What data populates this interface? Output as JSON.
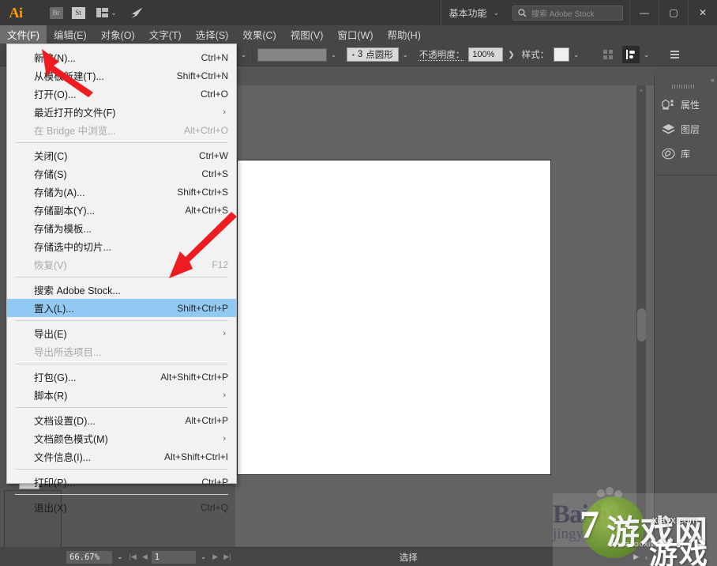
{
  "app": {
    "name": "Adobe Illustrator",
    "logo_text": "Ai"
  },
  "titlebar": {
    "bridge_icon_label": "Br",
    "stock_icon_label": "St",
    "workspace": "基本功能",
    "workspace_chevron": "⌄",
    "search_placeholder": "搜索 Adobe Stock",
    "minimize": "—",
    "maximize": "▢",
    "close": "✕"
  },
  "menubar": {
    "items": [
      {
        "label": "文件(F)",
        "active": true
      },
      {
        "label": "编辑(E)",
        "active": false
      },
      {
        "label": "对象(O)",
        "active": false
      },
      {
        "label": "文字(T)",
        "active": false
      },
      {
        "label": "选择(S)",
        "active": false
      },
      {
        "label": "效果(C)",
        "active": false
      },
      {
        "label": "视图(V)",
        "active": false
      },
      {
        "label": "窗口(W)",
        "active": false
      },
      {
        "label": "帮助(H)",
        "active": false
      }
    ]
  },
  "controlbar": {
    "chevron": "⌄",
    "stroke_dot": "▪",
    "stroke_value": "3",
    "stroke_profile": "点圆形",
    "opacity_label": "不透明度：",
    "opacity_value": "100%",
    "opacity_arrow": "❯",
    "style_label": "样式：",
    "fill_swatch_color": "#858585",
    "style_swatch_color": "#f0f0f0"
  },
  "doctab": {
    "close_glyph": "✖"
  },
  "right_panel": {
    "collapse_glyph": "«",
    "items": [
      {
        "label": "属性",
        "icon": "properties-icon"
      },
      {
        "label": "图层",
        "icon": "layers-icon"
      },
      {
        "label": "库",
        "icon": "libraries-icon"
      }
    ]
  },
  "statusbar": {
    "zoom_value": "66.67%",
    "zoom_chevron": "⌄",
    "nav_first": "|◀",
    "nav_prev": "◀",
    "page_value": "1",
    "page_chevron": "⌄",
    "nav_next": "▶",
    "nav_last": "▶|",
    "status_text": "选择",
    "right_play": "▶",
    "right_chev": "‹"
  },
  "file_menu": {
    "items": [
      {
        "label": "新建(N)...",
        "accel": "Ctrl+N",
        "disabled": false,
        "submenu": false,
        "selected": false,
        "sep_after": false
      },
      {
        "label": "从模板新建(T)...",
        "accel": "Shift+Ctrl+N",
        "disabled": false,
        "submenu": false,
        "selected": false,
        "sep_after": false
      },
      {
        "label": "打开(O)...",
        "accel": "Ctrl+O",
        "disabled": false,
        "submenu": false,
        "selected": false,
        "sep_after": false
      },
      {
        "label": "最近打开的文件(F)",
        "accel": "",
        "disabled": false,
        "submenu": true,
        "selected": false,
        "sep_after": false
      },
      {
        "label": "在 Bridge 中浏览...",
        "accel": "Alt+Ctrl+O",
        "disabled": true,
        "submenu": false,
        "selected": false,
        "sep_after": true
      },
      {
        "label": "关闭(C)",
        "accel": "Ctrl+W",
        "disabled": false,
        "submenu": false,
        "selected": false,
        "sep_after": false
      },
      {
        "label": "存储(S)",
        "accel": "Ctrl+S",
        "disabled": false,
        "submenu": false,
        "selected": false,
        "sep_after": false
      },
      {
        "label": "存储为(A)...",
        "accel": "Shift+Ctrl+S",
        "disabled": false,
        "submenu": false,
        "selected": false,
        "sep_after": false
      },
      {
        "label": "存储副本(Y)...",
        "accel": "Alt+Ctrl+S",
        "disabled": false,
        "submenu": false,
        "selected": false,
        "sep_after": false
      },
      {
        "label": "存储为模板...",
        "accel": "",
        "disabled": false,
        "submenu": false,
        "selected": false,
        "sep_after": false
      },
      {
        "label": "存储选中的切片...",
        "accel": "",
        "disabled": false,
        "submenu": false,
        "selected": false,
        "sep_after": false
      },
      {
        "label": "恢复(V)",
        "accel": "F12",
        "disabled": true,
        "submenu": false,
        "selected": false,
        "sep_after": true
      },
      {
        "label": "搜索 Adobe Stock...",
        "accel": "",
        "disabled": false,
        "submenu": false,
        "selected": false,
        "sep_after": false
      },
      {
        "label": "置入(L)...",
        "accel": "Shift+Ctrl+P",
        "disabled": false,
        "submenu": false,
        "selected": true,
        "sep_after": true
      },
      {
        "label": "导出(E)",
        "accel": "",
        "disabled": false,
        "submenu": true,
        "selected": false,
        "sep_after": false
      },
      {
        "label": "导出所选项目...",
        "accel": "",
        "disabled": true,
        "submenu": false,
        "selected": false,
        "sep_after": true
      },
      {
        "label": "打包(G)...",
        "accel": "Alt+Shift+Ctrl+P",
        "disabled": false,
        "submenu": false,
        "selected": false,
        "sep_after": false
      },
      {
        "label": "脚本(R)",
        "accel": "",
        "disabled": false,
        "submenu": true,
        "selected": false,
        "sep_after": true
      },
      {
        "label": "文档设置(D)...",
        "accel": "Alt+Ctrl+P",
        "disabled": false,
        "submenu": false,
        "selected": false,
        "sep_after": false
      },
      {
        "label": "文档颜色模式(M)",
        "accel": "",
        "disabled": false,
        "submenu": true,
        "selected": false,
        "sep_after": false
      },
      {
        "label": "文件信息(I)...",
        "accel": "Alt+Shift+Ctrl+I",
        "disabled": false,
        "submenu": false,
        "selected": false,
        "sep_after": true
      },
      {
        "label": "打印(P)...",
        "accel": "Ctrl+P",
        "disabled": false,
        "submenu": false,
        "selected": false,
        "sep_after": true
      },
      {
        "label": "退出(X)",
        "accel": "Ctrl+Q",
        "disabled": false,
        "submenu": false,
        "selected": false,
        "sep_after": false
      }
    ],
    "submenu_glyph": "›",
    "highlight_color": "#91c9f2"
  },
  "annotations": {
    "arrow_color": "#ee1c21",
    "arrow_count": 2
  },
  "watermarks": {
    "baidu_line1": "Baidu",
    "baidu_line2": "jingyan",
    "game_seven": "7",
    "game_cn_top": "游戏网",
    "game_cn_bottom": "游戏",
    "game_pinyin": "ZHAOYOUXIWANG",
    "site": "xiayx.com"
  }
}
